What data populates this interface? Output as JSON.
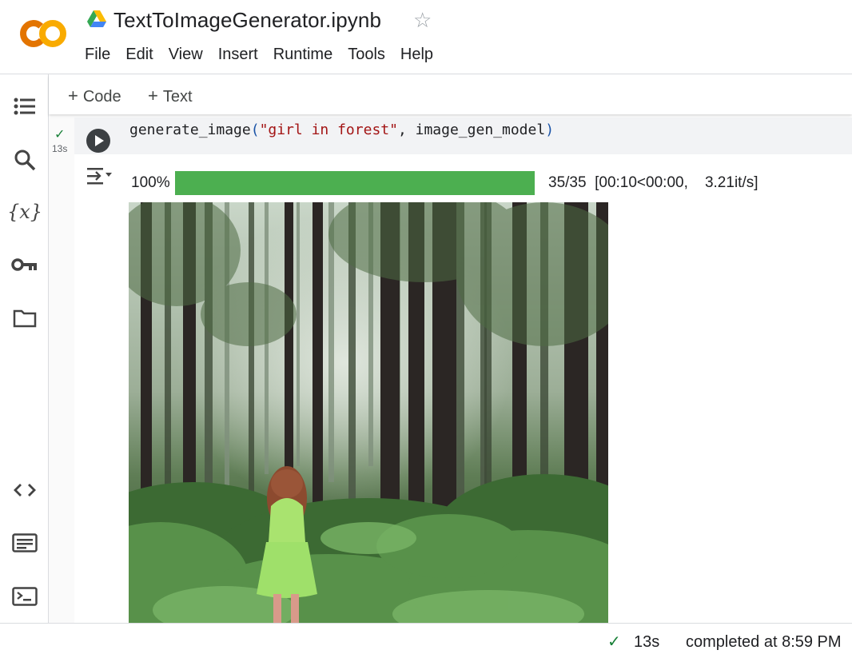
{
  "header": {
    "title": "TextToImageGenerator.ipynb",
    "logo_text": "CO",
    "menu": [
      "File",
      "Edit",
      "View",
      "Insert",
      "Runtime",
      "Tools",
      "Help"
    ]
  },
  "toolbar": {
    "add_code_label": "Code",
    "add_text_label": "Text"
  },
  "left_rail": {
    "icons": [
      "table-of-contents-icon",
      "search-icon",
      "variables-icon",
      "secrets-key-icon",
      "files-folder-icon",
      "code-snippets-icon",
      "command-palette-icon",
      "terminal-icon"
    ]
  },
  "cell": {
    "exec_time": "13s",
    "code": {
      "fn": "generate_image",
      "open": "(",
      "arg1": "\"girl in forest\"",
      "sep": ", image_gen_model",
      "close": ")"
    },
    "output": {
      "progress_percent_label": "100%",
      "progress_value": 1.0,
      "progress_stats": "35/35  [00:10<00:00,    3.21it/s]",
      "image_subject": "girl in forest"
    }
  },
  "status": {
    "duration": "13s",
    "completed": "completed at 8:59 PM"
  },
  "colors": {
    "progress": "#4caf50",
    "success": "#188038",
    "logo_orange": "#f9ab00",
    "logo_dark_orange": "#e37400"
  }
}
